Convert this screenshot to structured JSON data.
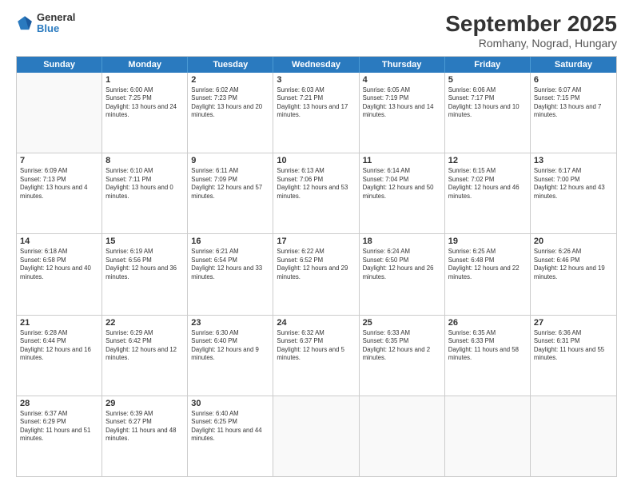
{
  "header": {
    "logo": {
      "line1": "General",
      "line2": "Blue"
    },
    "title": "September 2025",
    "subtitle": "Romhany, Nograd, Hungary"
  },
  "calendar": {
    "days": [
      "Sunday",
      "Monday",
      "Tuesday",
      "Wednesday",
      "Thursday",
      "Friday",
      "Saturday"
    ],
    "rows": [
      [
        {
          "day": "",
          "empty": true
        },
        {
          "day": "1",
          "sunrise": "Sunrise: 6:00 AM",
          "sunset": "Sunset: 7:25 PM",
          "daylight": "Daylight: 13 hours and 24 minutes."
        },
        {
          "day": "2",
          "sunrise": "Sunrise: 6:02 AM",
          "sunset": "Sunset: 7:23 PM",
          "daylight": "Daylight: 13 hours and 20 minutes."
        },
        {
          "day": "3",
          "sunrise": "Sunrise: 6:03 AM",
          "sunset": "Sunset: 7:21 PM",
          "daylight": "Daylight: 13 hours and 17 minutes."
        },
        {
          "day": "4",
          "sunrise": "Sunrise: 6:05 AM",
          "sunset": "Sunset: 7:19 PM",
          "daylight": "Daylight: 13 hours and 14 minutes."
        },
        {
          "day": "5",
          "sunrise": "Sunrise: 6:06 AM",
          "sunset": "Sunset: 7:17 PM",
          "daylight": "Daylight: 13 hours and 10 minutes."
        },
        {
          "day": "6",
          "sunrise": "Sunrise: 6:07 AM",
          "sunset": "Sunset: 7:15 PM",
          "daylight": "Daylight: 13 hours and 7 minutes."
        }
      ],
      [
        {
          "day": "7",
          "sunrise": "Sunrise: 6:09 AM",
          "sunset": "Sunset: 7:13 PM",
          "daylight": "Daylight: 13 hours and 4 minutes."
        },
        {
          "day": "8",
          "sunrise": "Sunrise: 6:10 AM",
          "sunset": "Sunset: 7:11 PM",
          "daylight": "Daylight: 13 hours and 0 minutes."
        },
        {
          "day": "9",
          "sunrise": "Sunrise: 6:11 AM",
          "sunset": "Sunset: 7:09 PM",
          "daylight": "Daylight: 12 hours and 57 minutes."
        },
        {
          "day": "10",
          "sunrise": "Sunrise: 6:13 AM",
          "sunset": "Sunset: 7:06 PM",
          "daylight": "Daylight: 12 hours and 53 minutes."
        },
        {
          "day": "11",
          "sunrise": "Sunrise: 6:14 AM",
          "sunset": "Sunset: 7:04 PM",
          "daylight": "Daylight: 12 hours and 50 minutes."
        },
        {
          "day": "12",
          "sunrise": "Sunrise: 6:15 AM",
          "sunset": "Sunset: 7:02 PM",
          "daylight": "Daylight: 12 hours and 46 minutes."
        },
        {
          "day": "13",
          "sunrise": "Sunrise: 6:17 AM",
          "sunset": "Sunset: 7:00 PM",
          "daylight": "Daylight: 12 hours and 43 minutes."
        }
      ],
      [
        {
          "day": "14",
          "sunrise": "Sunrise: 6:18 AM",
          "sunset": "Sunset: 6:58 PM",
          "daylight": "Daylight: 12 hours and 40 minutes."
        },
        {
          "day": "15",
          "sunrise": "Sunrise: 6:19 AM",
          "sunset": "Sunset: 6:56 PM",
          "daylight": "Daylight: 12 hours and 36 minutes."
        },
        {
          "day": "16",
          "sunrise": "Sunrise: 6:21 AM",
          "sunset": "Sunset: 6:54 PM",
          "daylight": "Daylight: 12 hours and 33 minutes."
        },
        {
          "day": "17",
          "sunrise": "Sunrise: 6:22 AM",
          "sunset": "Sunset: 6:52 PM",
          "daylight": "Daylight: 12 hours and 29 minutes."
        },
        {
          "day": "18",
          "sunrise": "Sunrise: 6:24 AM",
          "sunset": "Sunset: 6:50 PM",
          "daylight": "Daylight: 12 hours and 26 minutes."
        },
        {
          "day": "19",
          "sunrise": "Sunrise: 6:25 AM",
          "sunset": "Sunset: 6:48 PM",
          "daylight": "Daylight: 12 hours and 22 minutes."
        },
        {
          "day": "20",
          "sunrise": "Sunrise: 6:26 AM",
          "sunset": "Sunset: 6:46 PM",
          "daylight": "Daylight: 12 hours and 19 minutes."
        }
      ],
      [
        {
          "day": "21",
          "sunrise": "Sunrise: 6:28 AM",
          "sunset": "Sunset: 6:44 PM",
          "daylight": "Daylight: 12 hours and 16 minutes."
        },
        {
          "day": "22",
          "sunrise": "Sunrise: 6:29 AM",
          "sunset": "Sunset: 6:42 PM",
          "daylight": "Daylight: 12 hours and 12 minutes."
        },
        {
          "day": "23",
          "sunrise": "Sunrise: 6:30 AM",
          "sunset": "Sunset: 6:40 PM",
          "daylight": "Daylight: 12 hours and 9 minutes."
        },
        {
          "day": "24",
          "sunrise": "Sunrise: 6:32 AM",
          "sunset": "Sunset: 6:37 PM",
          "daylight": "Daylight: 12 hours and 5 minutes."
        },
        {
          "day": "25",
          "sunrise": "Sunrise: 6:33 AM",
          "sunset": "Sunset: 6:35 PM",
          "daylight": "Daylight: 12 hours and 2 minutes."
        },
        {
          "day": "26",
          "sunrise": "Sunrise: 6:35 AM",
          "sunset": "Sunset: 6:33 PM",
          "daylight": "Daylight: 11 hours and 58 minutes."
        },
        {
          "day": "27",
          "sunrise": "Sunrise: 6:36 AM",
          "sunset": "Sunset: 6:31 PM",
          "daylight": "Daylight: 11 hours and 55 minutes."
        }
      ],
      [
        {
          "day": "28",
          "sunrise": "Sunrise: 6:37 AM",
          "sunset": "Sunset: 6:29 PM",
          "daylight": "Daylight: 11 hours and 51 minutes."
        },
        {
          "day": "29",
          "sunrise": "Sunrise: 6:39 AM",
          "sunset": "Sunset: 6:27 PM",
          "daylight": "Daylight: 11 hours and 48 minutes."
        },
        {
          "day": "30",
          "sunrise": "Sunrise: 6:40 AM",
          "sunset": "Sunset: 6:25 PM",
          "daylight": "Daylight: 11 hours and 44 minutes."
        },
        {
          "day": "",
          "empty": true
        },
        {
          "day": "",
          "empty": true
        },
        {
          "day": "",
          "empty": true
        },
        {
          "day": "",
          "empty": true
        }
      ]
    ]
  }
}
